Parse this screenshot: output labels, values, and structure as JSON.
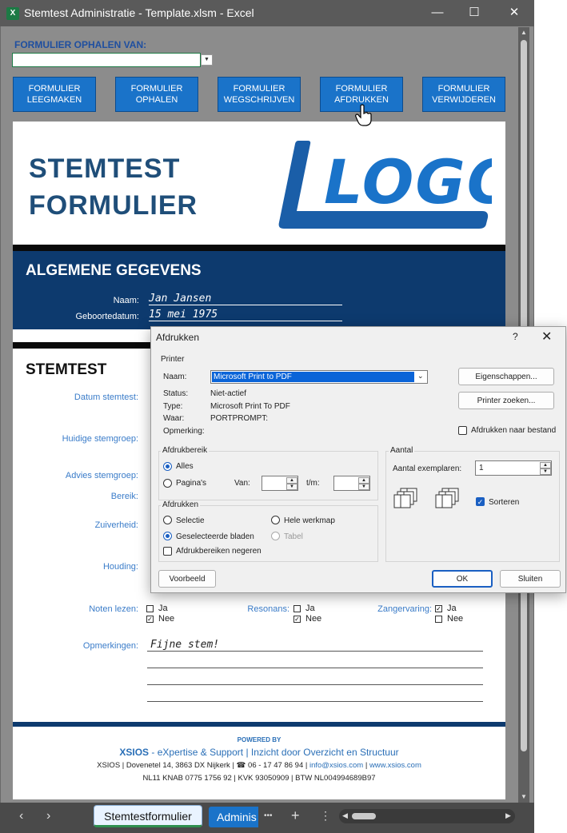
{
  "window": {
    "app_icon": "excel-icon",
    "title": "Stemtest Administratie - Template.xlsm - Excel",
    "minimize": "—",
    "maximize": "☐",
    "close": "✕"
  },
  "toolbar": {
    "fetch_label": "FORMULIER OPHALEN VAN:",
    "fetch_value": "",
    "buttons": [
      {
        "line1": "FORMULIER",
        "line2": "LEEGMAKEN"
      },
      {
        "line1": "FORMULIER",
        "line2": "OPHALEN"
      },
      {
        "line1": "FORMULIER",
        "line2": "WEGSCHRIJVEN"
      },
      {
        "line1": "FORMULIER",
        "line2": "AFDRUKKEN"
      },
      {
        "line1": "FORMULIER",
        "line2": "VERWIJDEREN"
      }
    ]
  },
  "form": {
    "title_line1": "STEMTEST",
    "title_line2": "FORMULIER",
    "logo_text": "LOGO",
    "general": {
      "heading": "ALGEMENE GEGEVENS",
      "name_label": "Naam:",
      "name_value": "Jan Jansen",
      "dob_label": "Geboortedatum:",
      "dob_value": "15 mei 1975"
    },
    "stemtest": {
      "heading": "STEMTEST",
      "date_label": "Datum stemtest:",
      "current_group_label": "Huidige stemgroep:",
      "advice_group_label": "Advies stemgroep:",
      "range_label": "Bereik:",
      "purity_label": "Zuiverheid:",
      "posture_label": "Houding:",
      "notes_reading": {
        "label": "Noten lezen:",
        "ja": "Ja",
        "nee": "Nee",
        "ja_checked": false,
        "nee_checked": true
      },
      "resonance": {
        "label": "Resonans:",
        "ja": "Ja",
        "nee": "Nee",
        "ja_checked": false,
        "nee_checked": true
      },
      "singing_exp": {
        "label": "Zangervaring:",
        "ja": "Ja",
        "nee": "Nee",
        "ja_checked": true,
        "nee_checked": false
      },
      "remarks_label": "Opmerkingen:",
      "remarks_value": "Fijne stem!"
    },
    "footer": {
      "powered_by": "POWERED BY",
      "xsios_brand": "XSIOS",
      "xsios_tag": " - eXpertise & Support | Inzicht door Overzicht en Structuur",
      "address": "XSIOS | Dovenetel 14, 3863 DX  Nijkerk | ☎ 06 - 17 47 86 94 | ",
      "email": "info@xsios.com",
      "sep": " | ",
      "website": "www.xsios.com",
      "legal": "NL11 KNAB 0775 1756 92 | KVK 93050909 | BTW NL004994689B97"
    }
  },
  "sheet_tabs": {
    "prev": "‹",
    "next": "›",
    "active": "Stemtestformulier",
    "second": "Adminis",
    "more": "•••",
    "add": "+",
    "menu": "⋮"
  },
  "dialog": {
    "title": "Afdrukken",
    "help": "?",
    "close": "✕",
    "printer_group": "Printer",
    "name_label": "Naam:",
    "printer_name": "Microsoft Print to PDF",
    "status_label": "Status:",
    "status_value": "Niet-actief",
    "type_label": "Type:",
    "type_value": "Microsoft Print To PDF",
    "where_label": "Waar:",
    "where_value": "PORTPROMPT:",
    "comment_label": "Opmerking:",
    "properties_btn": "Eigenschappen...",
    "find_printer_btn": "Printer zoeken...",
    "print_to_file": "Afdrukken naar bestand",
    "print_to_file_checked": false,
    "range_group": "Afdrukbereik",
    "range_all": "Alles",
    "range_pages": "Pagina's",
    "from_label": "Van:",
    "to_label": "t/m:",
    "from_value": "",
    "to_value": "",
    "print_group": "Afdrukken",
    "opt_selection": "Selectie",
    "opt_workbook": "Hele werkmap",
    "opt_sheets": "Geselecteerde bladen",
    "opt_table": "Tabel",
    "ignore_areas": "Afdrukbereiken negeren",
    "copies_group": "Aantal",
    "copies_label": "Aantal exemplaren:",
    "copies_value": "1",
    "collate": "Sorteren",
    "collate_checked": true,
    "preview_btn": "Voorbeeld",
    "ok_btn": "OK",
    "close_btn": "Sluiten"
  }
}
